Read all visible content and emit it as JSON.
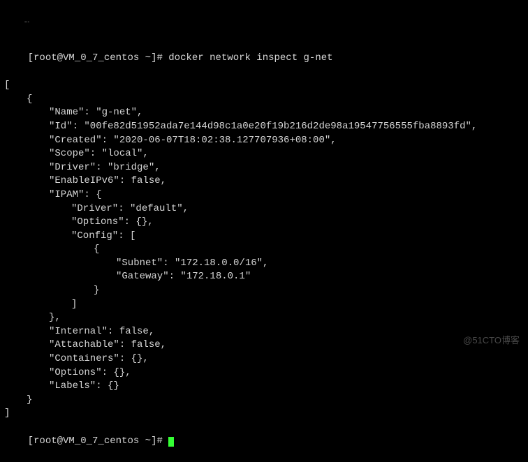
{
  "prompt": {
    "open": "[",
    "user_host": "root@VM_0_7_centos",
    "path": " ~",
    "close": "]# "
  },
  "command": "docker network inspect g-net",
  "truncated_header": "…",
  "output": {
    "l0": "[",
    "l1": "{",
    "l2": "\"Name\": \"g-net\",",
    "l3": "\"Id\": \"00fe82d51952ada7e144d98c1a0e20f19b216d2de98a19547756555fba8893fd\",",
    "l4": "\"Created\": \"2020-06-07T18:02:38.127707936+08:00\",",
    "l5": "\"Scope\": \"local\",",
    "l6": "\"Driver\": \"bridge\",",
    "l7": "\"EnableIPv6\": false,",
    "l8": "\"IPAM\": {",
    "l9": "\"Driver\": \"default\",",
    "l10": "\"Options\": {},",
    "l11": "\"Config\": [",
    "l12": "{",
    "l13": "\"Subnet\": \"172.18.0.0/16\",",
    "l14": "\"Gateway\": \"172.18.0.1\"",
    "l15": "}",
    "l16": "]",
    "l17": "},",
    "l18": "\"Internal\": false,",
    "l19": "\"Attachable\": false,",
    "l20": "\"Containers\": {},",
    "l21": "\"Options\": {},",
    "l22": "\"Labels\": {}",
    "l23": "}",
    "l24": "]"
  },
  "watermark": "@51CTO博客"
}
